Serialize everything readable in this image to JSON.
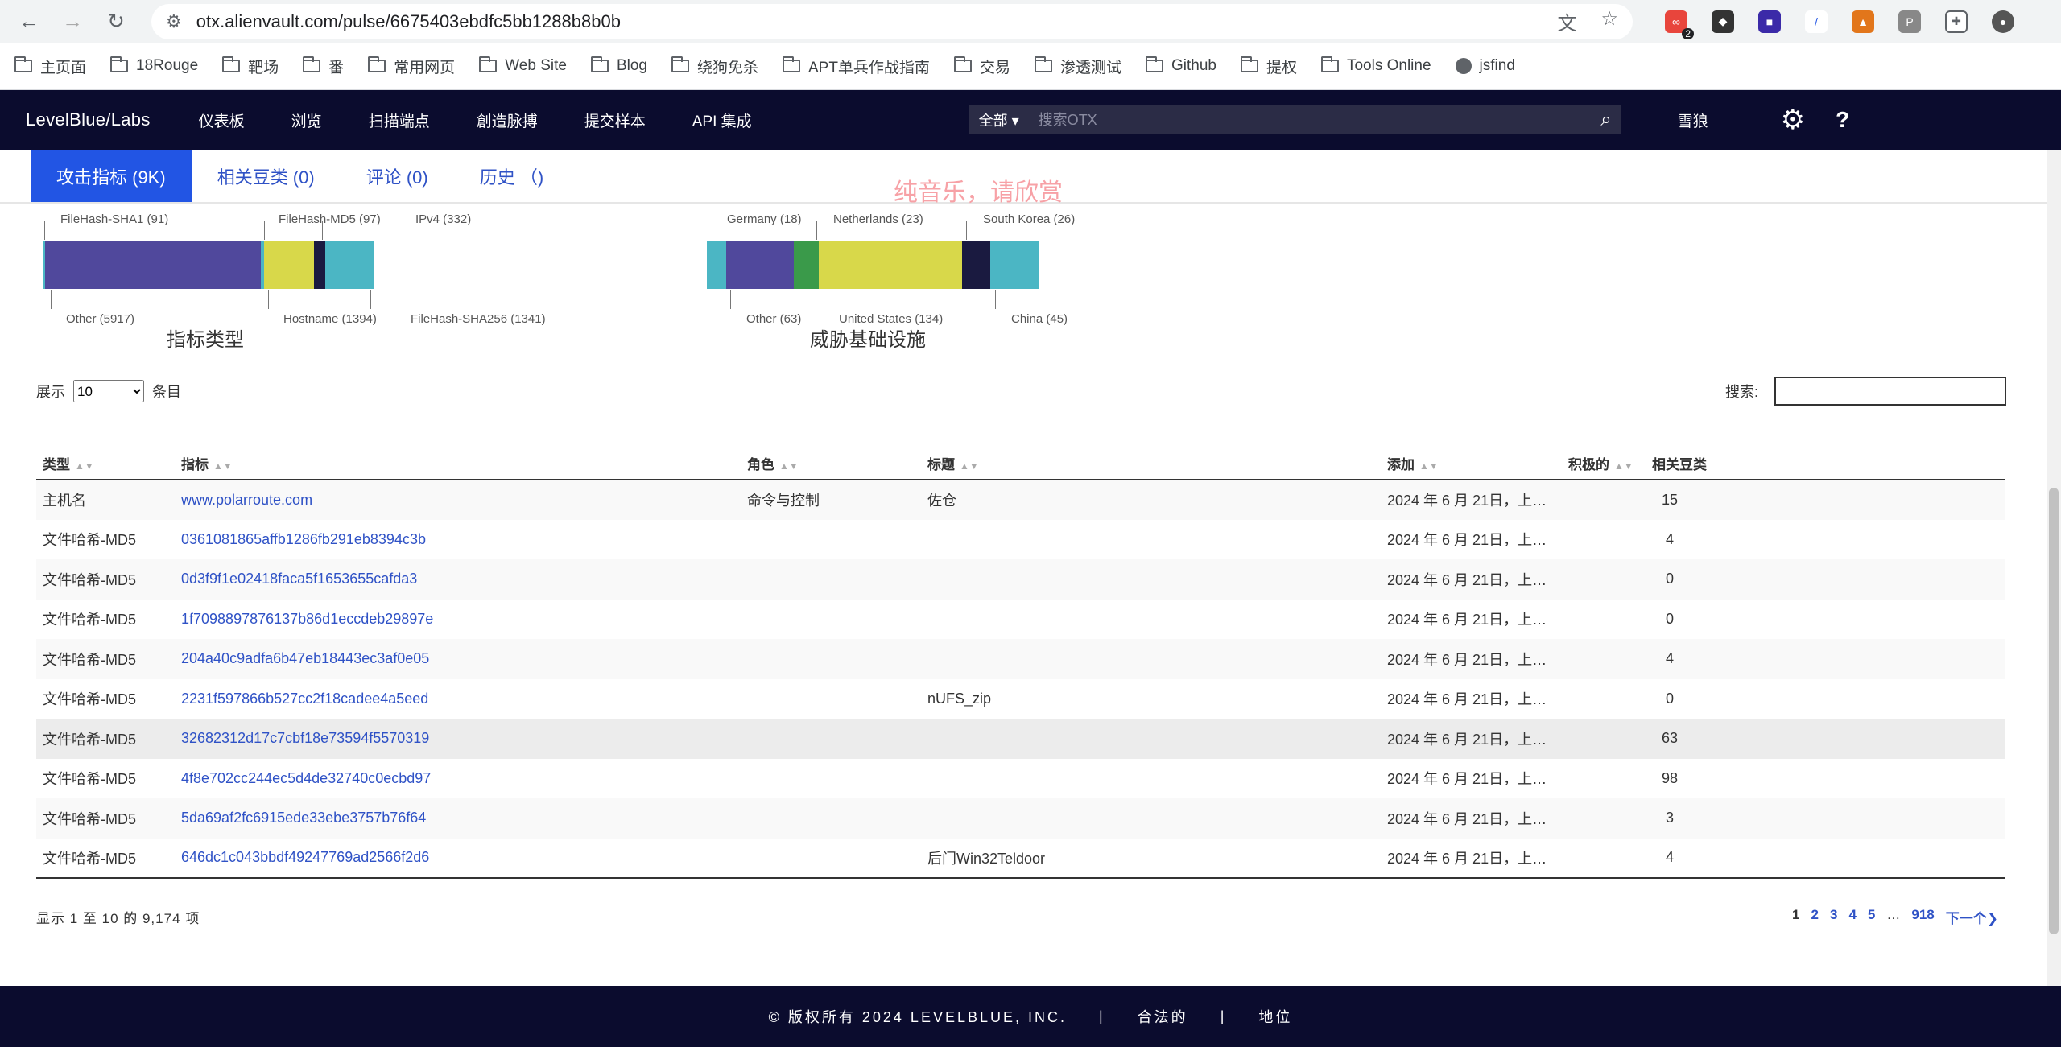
{
  "browser": {
    "url": "otx.alienvault.com/pulse/6675403ebdfc5bb1288b8b0b",
    "ext_badge": "2"
  },
  "bookmarks": [
    {
      "label": "主页面",
      "type": "folder"
    },
    {
      "label": "18Rouge",
      "type": "folder"
    },
    {
      "label": "靶场",
      "type": "folder"
    },
    {
      "label": "番",
      "type": "folder"
    },
    {
      "label": "常用网页",
      "type": "folder"
    },
    {
      "label": "Web Site",
      "type": "folder"
    },
    {
      "label": "Blog",
      "type": "folder"
    },
    {
      "label": "绕狗免杀",
      "type": "folder"
    },
    {
      "label": "APT单兵作战指南",
      "type": "folder"
    },
    {
      "label": "交易",
      "type": "folder"
    },
    {
      "label": "渗透测试",
      "type": "folder"
    },
    {
      "label": "Github",
      "type": "folder"
    },
    {
      "label": "提权",
      "type": "folder"
    },
    {
      "label": "Tools Online",
      "type": "folder"
    },
    {
      "label": "jsfind",
      "type": "link"
    }
  ],
  "nav": {
    "logo": "LevelBlue/Labs",
    "items": [
      "仪表板",
      "浏览",
      "扫描端点",
      "創造脉搏",
      "提交样本",
      "API 集成"
    ],
    "search_scope": "全部",
    "search_placeholder": "搜索OTX",
    "user": "雪狼"
  },
  "tabs": [
    {
      "label": "攻击指标 (9K)",
      "active": true
    },
    {
      "label": "相关豆类 (0)",
      "active": false
    },
    {
      "label": "评论 (0)",
      "active": false
    },
    {
      "label": "历史 （)",
      "active": false
    }
  ],
  "overlay_text": "纯音乐，请欣赏",
  "indicator_types": {
    "title": "指标类型",
    "segments": [
      {
        "label": "Other (5917)",
        "color": "#4bb6c4"
      },
      {
        "label": "FileHash-SHA1 (91)",
        "color": "#50489c"
      },
      {
        "label": "FileHash-MD5 (97)",
        "color": "#d8d84a"
      },
      {
        "label": "Hostname (1394)",
        "color": "#d8d84a"
      },
      {
        "label": "IPv4 (332)",
        "color": "#1a1a40"
      },
      {
        "label": "FileHash-SHA256 (1341)",
        "color": "#4bb6c4"
      }
    ]
  },
  "threat_infra": {
    "title": "威胁基础设施",
    "segments": [
      {
        "label": "Germany (18)",
        "color": "#4bb6c4"
      },
      {
        "label": "Other (63)",
        "color": "#50489c"
      },
      {
        "label": "Netherlands (23)",
        "color": "#3a9a4a"
      },
      {
        "label": "United States (134)",
        "color": "#d8d84a"
      },
      {
        "label": "South Korea (26)",
        "color": "#1a1a40"
      },
      {
        "label": "China (45)",
        "color": "#4bb6c4"
      }
    ]
  },
  "table_controls": {
    "show_label": "展示",
    "page_size": "10",
    "entries_label": "条目",
    "search_label": "搜索:"
  },
  "table": {
    "columns": [
      "类型",
      "指标",
      "角色",
      "标题",
      "添加",
      "积极的",
      "相关豆类"
    ],
    "rows": [
      [
        "主机名",
        "www.polarroute.com",
        "命令与控制",
        "佐仓",
        "2024 年 6 月 21日，上…",
        "",
        "15"
      ],
      [
        "文件哈希-MD5",
        "0361081865affb1286fb291eb8394c3b",
        "",
        "",
        "2024 年 6 月 21日，上…",
        "",
        "4"
      ],
      [
        "文件哈希-MD5",
        "0d3f9f1e02418faca5f1653655cafda3",
        "",
        "",
        "2024 年 6 月 21日，上…",
        "",
        "0"
      ],
      [
        "文件哈希-MD5",
        "1f7098897876137b86d1eccdeb29897e",
        "",
        "",
        "2024 年 6 月 21日，上…",
        "",
        "0"
      ],
      [
        "文件哈希-MD5",
        "204a40c9adfa6b47eb18443ec3af0e05",
        "",
        "",
        "2024 年 6 月 21日，上…",
        "",
        "4"
      ],
      [
        "文件哈希-MD5",
        "2231f597866b527cc2f18cadee4a5eed",
        "",
        "nUFS_zip",
        "2024 年 6 月 21日，上…",
        "",
        "0"
      ],
      [
        "文件哈希-MD5",
        "32682312d17c7cbf18e73594f5570319",
        "",
        "",
        "2024 年 6 月 21日，上…",
        "",
        "63"
      ],
      [
        "文件哈希-MD5",
        "4f8e702cc244ec5d4de32740c0ecbd97",
        "",
        "",
        "2024 年 6 月 21日，上…",
        "",
        "98"
      ],
      [
        "文件哈希-MD5",
        "5da69af2fc6915ede33ebe3757b76f64",
        "",
        "",
        "2024 年 6 月 21日，上…",
        "",
        "3"
      ],
      [
        "文件哈希-MD5",
        "646dc1c043bbdf49247769ad2566f2d6",
        "",
        "后门Win32Teldoor",
        "2024 年 6 月 21日，上…",
        "",
        "4"
      ]
    ]
  },
  "info": "显示 1 至 10 的 9,174 项",
  "pager": {
    "pages": [
      "1",
      "2",
      "3",
      "4",
      "5"
    ],
    "ellipsis": "…",
    "last": "918",
    "next": "下一个"
  },
  "footer": {
    "copyright": "© 版权所有 2024 LEVELBLUE, INC.",
    "sep": "|",
    "legal": "合法的",
    "status": "地位"
  }
}
